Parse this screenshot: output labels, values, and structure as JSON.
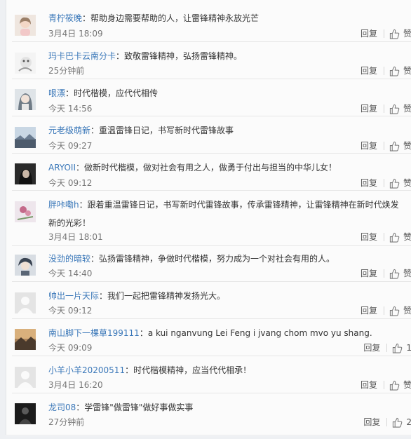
{
  "comments": [
    {
      "user": "青柠筱晚",
      "text": "帮助身边需要帮助的人，让雷锋精神永放光芒",
      "time": "3月4日 18:09",
      "reply": "回复",
      "like": "赞",
      "avatar": "girl-portrait-avatar"
    },
    {
      "user": "玛卡巴卡云南分卡",
      "text": "致敬雷锋精神，弘扬雷锋精神。",
      "time": "25分钟前",
      "reply": "回复",
      "like": "赞",
      "avatar": "cartoon-avatar"
    },
    {
      "user": "哏漂",
      "text": "时代楷模，应代代相传",
      "time": "今天 14:56",
      "reply": "回复",
      "like": "赞",
      "avatar": "anime-girl-avatar"
    },
    {
      "user": "元老级萌新",
      "text": "重温雷锋日记，书写新时代雷锋故事",
      "time": "今天 09:27",
      "reply": "回复",
      "like": "赞",
      "avatar": "landscape-avatar"
    },
    {
      "user": "ARYOII",
      "text": "做新时代楷模，做对社会有用之人，做勇于付出与担当的中华儿女！",
      "time": "今天 09:12",
      "reply": "回复",
      "like": "赞",
      "avatar": "dark-portrait-avatar"
    },
    {
      "user": "胖咔嘞h",
      "text": "跟着重温雷锋日记，书写新时代雷锋故事，传承雷锋精神，让雷锋精神在新时代焕发新的光彩！",
      "time": "3月4日 18:01",
      "reply": "回复",
      "like": "赞",
      "avatar": "flower-avatar"
    },
    {
      "user": "没劲的暗较",
      "text": "弘扬雷锋精神，争做时代楷模，努力成为一个对社会有用的人。",
      "time": "今天 14:40",
      "reply": "回复",
      "like": "赞",
      "avatar": "anime-boy-avatar"
    },
    {
      "user": "帅出一片天际",
      "text": "我们一起把雷锋精神发扬光大。",
      "time": "今天 09:12",
      "reply": "回复",
      "like": "赞",
      "avatar": "default-user-avatar"
    },
    {
      "user": "南山脚下一棵草199111",
      "text": "a kui nganvung  Lei Feng i jvang chom mvo yu shang.",
      "time": "今天 09:09",
      "reply": "回复",
      "like": "1",
      "avatar": "mountain-sunset-avatar"
    },
    {
      "user": "小羊小羊20200511",
      "text": "时代楷模精神，应当代代相承！",
      "time": "3月4日 16:20",
      "reply": "回复",
      "like": "赞",
      "avatar": "default-user-avatar"
    },
    {
      "user": "龙司08",
      "text": "学雷锋\"做雷锋\"做好事做实事",
      "time": "27分钟前",
      "reply": "回复",
      "like": "2",
      "avatar": "dark-figure-avatar"
    }
  ],
  "colors": {
    "username": "#3b78b9",
    "text": "#333333",
    "meta": "#777777",
    "divider": "#e6e6e6"
  }
}
